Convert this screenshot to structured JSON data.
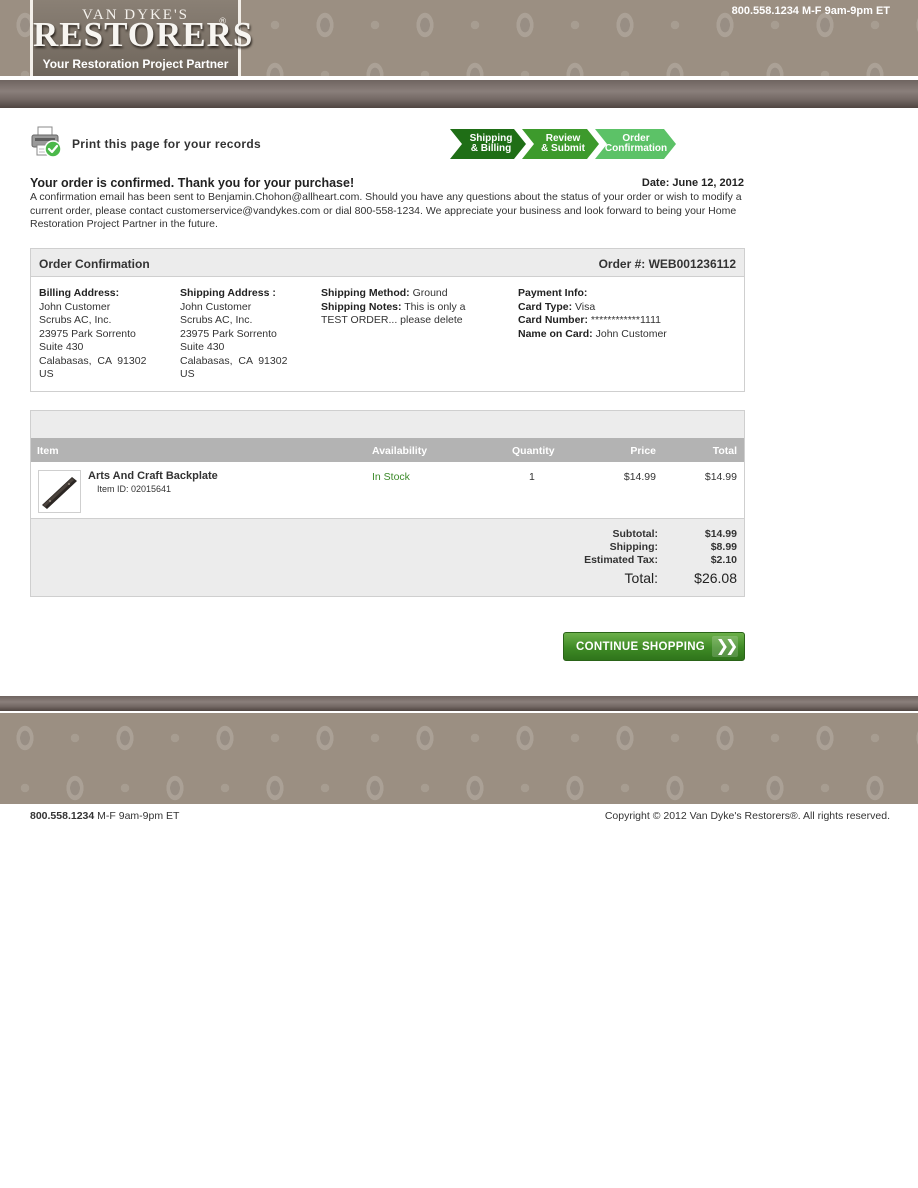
{
  "header": {
    "logo_small": "VAN DYKE'S",
    "logo_big": "RESTORERS",
    "logo_reg": "®",
    "tagline": "Your Restoration Project Partner",
    "phone_hours": "800.558.1234 M-F 9am-9pm ET"
  },
  "print": {
    "label": "Print this page for your records",
    "icon": "printer-check-icon"
  },
  "steps": [
    {
      "line1": "Shipping",
      "line2": "& Billing",
      "color": "#1f6e16"
    },
    {
      "line1": "Review",
      "line2": "& Submit",
      "color": "#3d9a2c"
    },
    {
      "line1": "Order",
      "line2": "Confirmation",
      "color": "#5cc267"
    }
  ],
  "confirmation": {
    "title": "Your order is confirmed. Thank you for your purchase!",
    "date": "Date: June 12, 2012",
    "message": "A confirmation email has been sent to Benjamin.Chohon@allheart.com. Should you have any questions about the status of your order or wish to modify a current order, please contact customerservice@vandykes.com or dial 800-558-1234. We appreciate your business and look forward to being your Home Restoration Project Partner in the future."
  },
  "order": {
    "heading": "Order Confirmation",
    "order_number": "Order #:  WEB001236112",
    "billing": {
      "label": "Billing Address:",
      "name": "John Customer",
      "company": "Scrubs AC, Inc.",
      "street": "23975 Park Sorrento",
      "suite": "Suite 430",
      "city": "Calabasas,  CA  91302",
      "country": "US"
    },
    "shipping": {
      "label": "Shipping Address :",
      "name": "John Customer",
      "company": "Scrubs AC, Inc.",
      "street": "23975 Park Sorrento",
      "suite": "Suite 430",
      "city": "Calabasas,  CA  91302",
      "country": "US"
    },
    "method": {
      "method_label": "Shipping Method:",
      "method_value": " Ground",
      "notes_label": "Shipping Notes:",
      "notes_value": " This is only a",
      "notes_value2": "TEST ORDER... please delete"
    },
    "payment": {
      "label": "Payment Info:",
      "card_type_label": "Card Type:",
      "card_type_value": " Visa",
      "card_number_label": "Card Number:",
      "card_number_value": " ************1111",
      "name_label": "Name on Card:",
      "name_value": " John Customer"
    }
  },
  "cart": {
    "columns": {
      "item": "Item",
      "availability": "Availability",
      "quantity": "Quantity",
      "price": "Price",
      "total": "Total"
    },
    "items": [
      {
        "name": "Arts And Craft Backplate",
        "item_id": "Item ID: 02015641",
        "availability": "In Stock",
        "quantity": "1",
        "price": "$14.99",
        "total": "$14.99"
      }
    ],
    "totals": {
      "subtotal_label": "Subtotal:",
      "subtotal": "$14.99",
      "shipping_label": "Shipping:",
      "shipping": "$8.99",
      "tax_label": "Estimated Tax:",
      "tax": "$2.10",
      "total_label": "Total:",
      "total": "$26.08"
    }
  },
  "actions": {
    "continue_label": "CONTINUE SHOPPING",
    "continue_arrow": "❯❯"
  },
  "footer": {
    "phone": "800.558.1234",
    "hours": " M-F 9am-9pm ET",
    "copyright": "Copyright © 2012 Van Dyke's Restorers®. All rights reserved."
  },
  "colors": {
    "brand_taupe": "#9b8f82",
    "stock_green": "#3c8a2a",
    "button_green": "#3e8a25"
  }
}
